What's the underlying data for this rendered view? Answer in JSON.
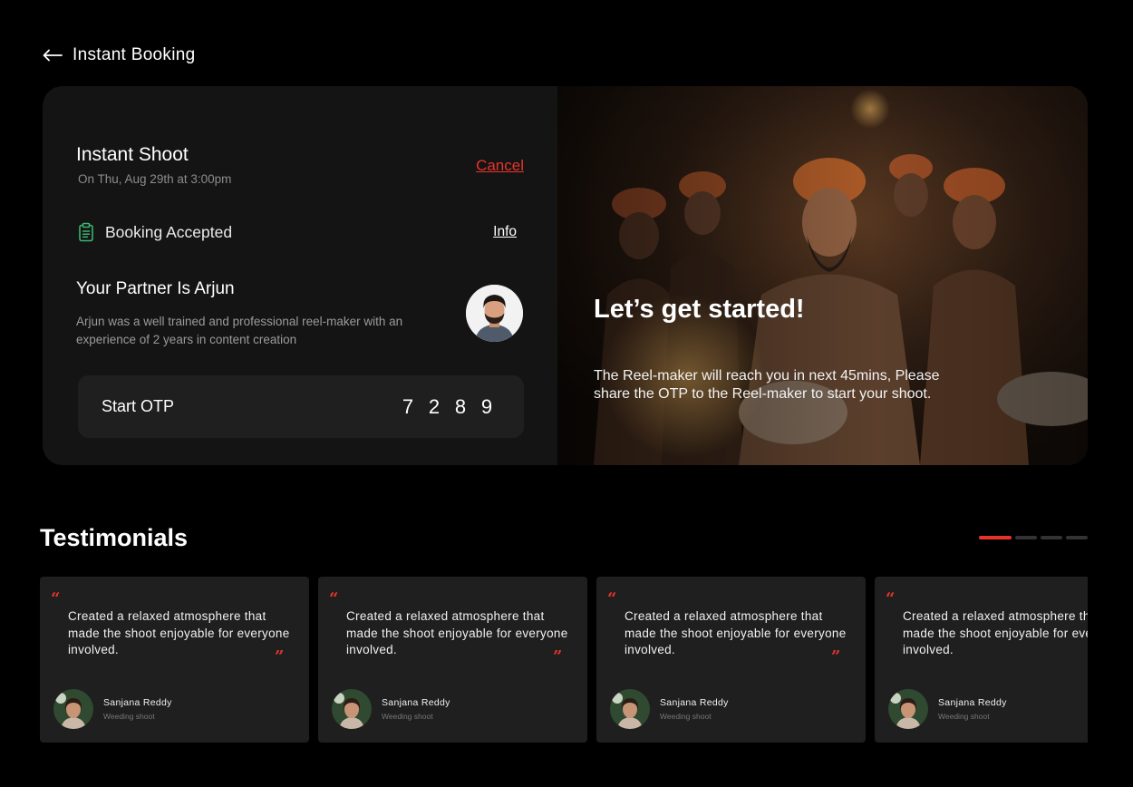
{
  "header": {
    "title": "Instant Booking",
    "back_icon": "arrow-left-icon"
  },
  "booking": {
    "title": "Instant Shoot",
    "datetime": "On Thu, Aug 29th at 3:00pm",
    "cancel_label": "Cancel",
    "status_icon": "clipboard-icon",
    "status": "Booking Accepted",
    "info_label": "Info",
    "partner_title": "Your Partner Is Arjun",
    "partner_description": "Arjun was a well trained and professional reel-maker with an experience of 2 years in content creation",
    "otp_label": "Start OTP",
    "otp_digits": [
      "7",
      "2",
      "8",
      "9"
    ]
  },
  "hero": {
    "heading": "Let’s get started!",
    "message": "The Reel-maker will reach you in next 45mins, Please share the OTP to the Reel-maker to start your shoot."
  },
  "testimonials": {
    "title": "Testimonials",
    "pager_count": 4,
    "active_page": 1,
    "items": [
      {
        "quote": "Created a relaxed atmosphere that made the shoot enjoyable for everyone involved.",
        "name": "Sanjana Reddy",
        "role": "Weeding shoot"
      },
      {
        "quote": "Created a relaxed atmosphere that made the shoot enjoyable for everyone involved.",
        "name": "Sanjana Reddy",
        "role": "Weeding shoot"
      },
      {
        "quote": "Created a relaxed atmosphere that made the shoot enjoyable for everyone involved.",
        "name": "Sanjana Reddy",
        "role": "Weeding shoot"
      },
      {
        "quote": "Created a relaxed atmosphere that made the shoot enjoyable for everyone involved.",
        "name": "Sanjana Reddy",
        "role": "Weeding shoot"
      }
    ]
  },
  "colors": {
    "accent": "#e8332b",
    "status_green": "#3cb371",
    "background": "#000000",
    "card": "#141414"
  }
}
